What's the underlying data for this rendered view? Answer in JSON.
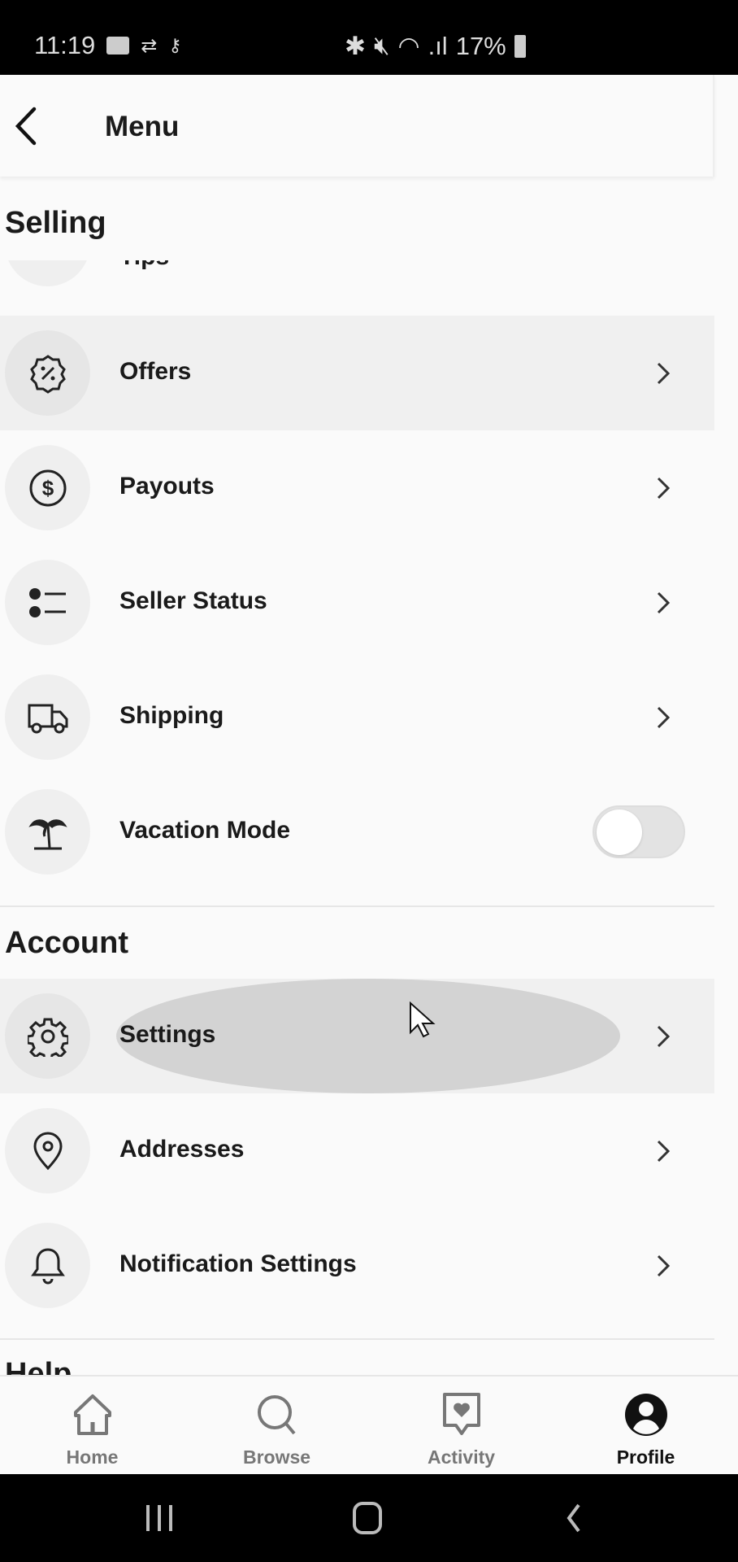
{
  "status_bar": {
    "time": "11:19",
    "battery": "17%"
  },
  "header": {
    "title": "Menu"
  },
  "sections": {
    "selling": {
      "title": "Selling",
      "partial_item": "Tips",
      "items": [
        {
          "label": "Offers",
          "icon": "discount-badge-icon"
        },
        {
          "label": "Payouts",
          "icon": "dollar-circle-icon"
        },
        {
          "label": "Seller Status",
          "icon": "checklist-icon"
        },
        {
          "label": "Shipping",
          "icon": "truck-icon"
        },
        {
          "label": "Vacation Mode",
          "icon": "palm-tree-icon",
          "toggle": false
        }
      ]
    },
    "account": {
      "title": "Account",
      "items": [
        {
          "label": "Settings",
          "icon": "gear-icon"
        },
        {
          "label": "Addresses",
          "icon": "location-pin-icon"
        },
        {
          "label": "Notification Settings",
          "icon": "bell-icon"
        }
      ]
    },
    "help": {
      "title": "Help"
    }
  },
  "bottom_nav": [
    {
      "label": "Home"
    },
    {
      "label": "Browse"
    },
    {
      "label": "Activity"
    },
    {
      "label": "Profile",
      "active": true
    }
  ]
}
